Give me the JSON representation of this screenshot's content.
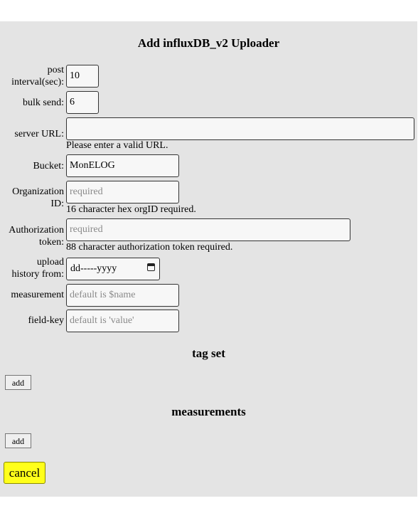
{
  "form": {
    "title": "Add influxDB_v2 Uploader",
    "post_interval": {
      "label_line1": "post",
      "label_line2": "interval(sec):",
      "value": "10"
    },
    "bulk_send": {
      "label": "bulk send:",
      "value": "6"
    },
    "server_url": {
      "label": "server URL:",
      "value": "",
      "hint": "Please enter a valid URL."
    },
    "bucket": {
      "label": "Bucket:",
      "value": "MonELOG"
    },
    "organization_id": {
      "label_line1": "Organization",
      "label_line2": "ID:",
      "placeholder": "required",
      "hint": "16 character hex orgID required."
    },
    "authorization_token": {
      "label_line1": "Authorization",
      "label_line2": "token:",
      "placeholder": "required",
      "hint": "88 character authorization token required."
    },
    "upload_history": {
      "label_line1": "upload",
      "label_line2": "history from:",
      "display": "dd-----yyyy"
    },
    "measurement": {
      "label": "measurement",
      "placeholder": "default is $name"
    },
    "field_key": {
      "label": "field-key",
      "placeholder": "default is 'value'"
    }
  },
  "tag_set": {
    "heading": "tag set",
    "add_label": "add"
  },
  "measurements": {
    "heading": "measurements",
    "add_label": "add"
  },
  "actions": {
    "cancel_label": "cancel"
  },
  "icons": {
    "calendar": "calendar-icon"
  }
}
